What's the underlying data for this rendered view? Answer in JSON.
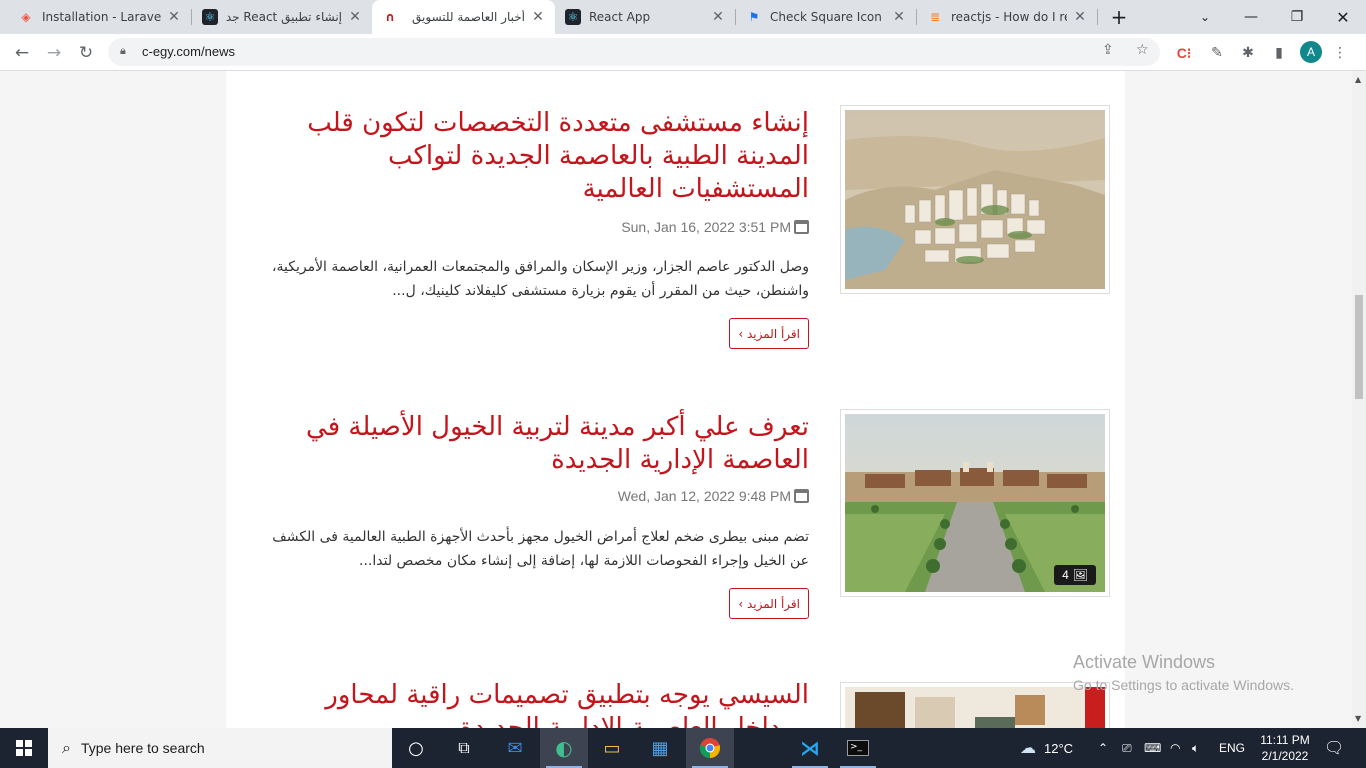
{
  "browser": {
    "tabs": [
      {
        "title": "Installation - Laravel -",
        "icon": "laravel-icon",
        "color": "#f05340",
        "active": false
      },
      {
        "title": "إنشاء تطبيق React جديد",
        "icon": "react-icon",
        "color": "#61dafb",
        "active": false
      },
      {
        "title": "أخبار العاصمة للتسويق",
        "icon": "site-icon",
        "color": "#c3151b",
        "active": true
      },
      {
        "title": "React App",
        "icon": "react-icon",
        "color": "#61dafb",
        "active": false
      },
      {
        "title": "Check Square Icon - R",
        "icon": "flag-icon",
        "color": "#1a73e8",
        "active": false
      },
      {
        "title": "reactjs - How do I refe",
        "icon": "stackoverflow-icon",
        "color": "#f48024",
        "active": false
      }
    ],
    "new_tab": "+",
    "url": "c-egy.com/news"
  },
  "articles": [
    {
      "title": "إنشاء مستشفى متعددة التخصصات لتكون قلب المدينة الطبية بالعاصمة الجديدة لتواكب المستشفيات العالمية",
      "date": "Sun, Jan 16, 2022 3:51 PM",
      "excerpt": "وصل الدكتور عاصم الجزار، وزير الإسكان والمرافق والمجتمعات العمرانية، العاصمة الأمريكية، واشنطن، حيث من المقرر أن يقوم بزيارة مستشفى كليفلاند كلينيك، ل...",
      "read_more": "اقرأ المزيد ›"
    },
    {
      "title": "تعرف علي أكبر مدينة لتربية الخيول الأصيلة في العاصمة الإدارية الجديدة",
      "date": "Wed, Jan 12, 2022 9:48 PM",
      "excerpt": "تضم مبنى بيطرى ضخم لعلاج أمراض الخيول مجهز بأحدث الأجهزة الطبية العالمية فى الكشف عن الخيل وإجراء الفحوصات اللازمة لها، إضافة إلى إنشاء مكان مخصص لتدا...",
      "read_more": "اقرأ المزيد ›",
      "photo_count": "4"
    },
    {
      "title": "السيسي يوجه بتطبيق تصميمات راقية لمحاور ومداخل العاصمة الإدارية الجديدة"
    }
  ],
  "watermark": {
    "line1": "Activate Windows",
    "line2": "Go to Settings to activate Windows."
  },
  "taskbar": {
    "search_placeholder": "Type here to search",
    "weather": "12°C",
    "language": "ENG",
    "time": "11:11 PM",
    "date": "2/1/2022"
  },
  "colors": {
    "accent": "#c3151b",
    "taskbar": "#1c2431"
  }
}
